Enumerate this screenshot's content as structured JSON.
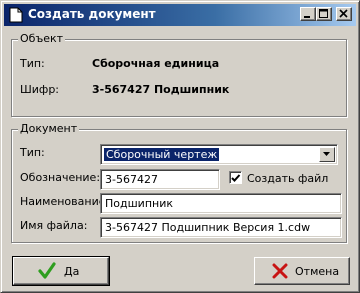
{
  "window": {
    "title": "Создать документ",
    "controls": [
      "minimize-icon",
      "maximize-icon",
      "close-icon"
    ]
  },
  "object_group": {
    "legend": "Объект",
    "type_label": "Тип:",
    "type_value": "Сборочная единица",
    "code_label": "Шифр:",
    "code_value": "3-567427 Подшипник"
  },
  "document_group": {
    "legend": "Документ",
    "type_label": "Тип:",
    "type_selected": "Сборочный чертеж",
    "designation_label": "Обозначение:",
    "designation_value": "3-567427",
    "create_file_label": "Создать файл",
    "create_file_checked": true,
    "name_label": "Наименование:",
    "name_value": "Подшипник",
    "filename_label": "Имя файла:",
    "filename_value": "3-567427 Подшипник Версия 1.cdw"
  },
  "buttons": {
    "ok_label": "Да",
    "cancel_label": "Отмена"
  },
  "colors": {
    "titlebar": "#0a246a",
    "ok_check": "#2e9e1f",
    "cancel_x": "#c81414"
  }
}
